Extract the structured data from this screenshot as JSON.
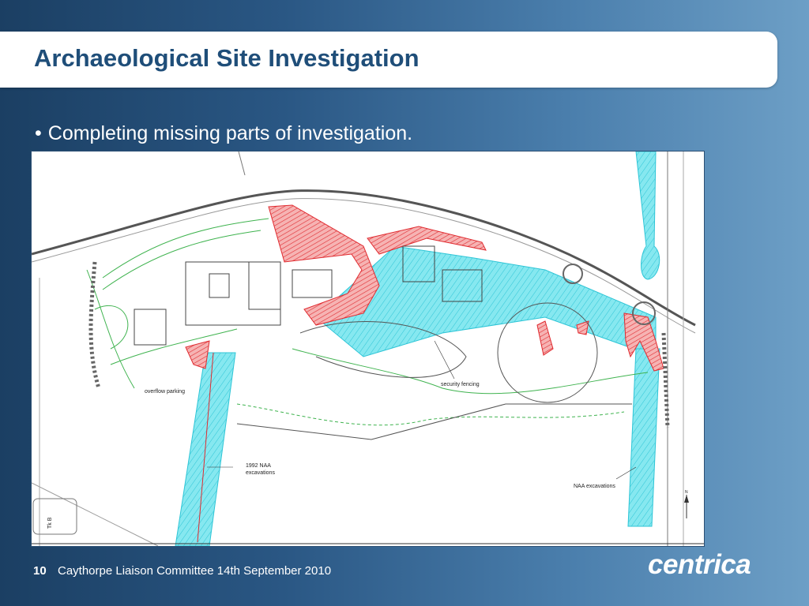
{
  "slide": {
    "title": "Archaeological Site Investigation",
    "bullet": "Completing missing parts of investigation.",
    "bullet_glyph": "•",
    "page_number": "10",
    "footer": "Caythorpe Liaison Committee 14th September 2010",
    "logo_text": "centrica"
  },
  "map_labels": {
    "overflow_parking": "overflow parking",
    "security_fencing": "security fencing",
    "naa_1992_line1": "1992 NAA",
    "naa_1992_line2": "excavations",
    "naa_excavations": "NAA excavations",
    "tk_b": "Tk B",
    "north": "N"
  },
  "colors": {
    "title": "#1f4e79",
    "excavation_fill": "#7fe6ee",
    "missing_fill": "#e8383c",
    "contour": "#3fb34f"
  }
}
